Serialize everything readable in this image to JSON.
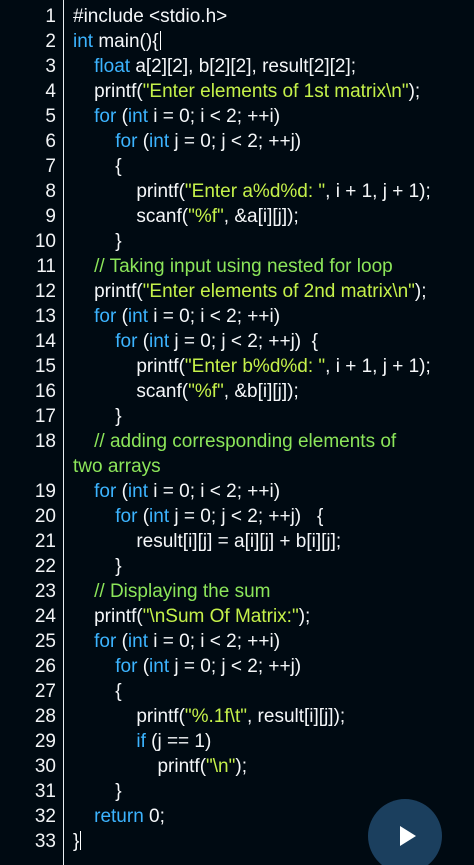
{
  "editor": {
    "lines": [
      {
        "no": "1",
        "tokens": [
          {
            "t": "#include <stdio.h>",
            "c": "plain"
          }
        ]
      },
      {
        "no": "2",
        "tokens": [
          {
            "t": "int",
            "c": "kw"
          },
          {
            "t": " main(){",
            "c": "plain"
          }
        ],
        "cursor": true
      },
      {
        "no": "3",
        "tokens": [
          {
            "t": "    "
          },
          {
            "t": "float",
            "c": "kw"
          },
          {
            "t": " a[2][2], b[2][2], result[2][2];"
          }
        ]
      },
      {
        "no": "4",
        "tokens": [
          {
            "t": "    printf("
          },
          {
            "t": "\"Enter elements of 1st matrix\\n\"",
            "c": "str"
          },
          {
            "t": ");"
          }
        ]
      },
      {
        "no": "5",
        "tokens": [
          {
            "t": "    "
          },
          {
            "t": "for",
            "c": "kw"
          },
          {
            "t": " ("
          },
          {
            "t": "int",
            "c": "kw"
          },
          {
            "t": " i = 0; i < 2; ++i)"
          }
        ]
      },
      {
        "no": "6",
        "tokens": [
          {
            "t": "        "
          },
          {
            "t": "for",
            "c": "kw"
          },
          {
            "t": " ("
          },
          {
            "t": "int",
            "c": "kw"
          },
          {
            "t": " j = 0; j < 2; ++j)"
          }
        ]
      },
      {
        "no": "7",
        "tokens": [
          {
            "t": "        {"
          }
        ]
      },
      {
        "no": "8",
        "tokens": [
          {
            "t": "            printf("
          },
          {
            "t": "\"Enter a%d%d: \"",
            "c": "str"
          },
          {
            "t": ", i + 1, j + 1);"
          }
        ]
      },
      {
        "no": "9",
        "tokens": [
          {
            "t": "            scanf("
          },
          {
            "t": "\"%f\"",
            "c": "str"
          },
          {
            "t": ", &a[i][j]);"
          }
        ]
      },
      {
        "no": "10",
        "tokens": [
          {
            "t": "        }"
          }
        ]
      },
      {
        "no": "11",
        "tokens": [
          {
            "t": "    "
          },
          {
            "t": "// Taking input using nested for loop",
            "c": "com"
          }
        ]
      },
      {
        "no": "12",
        "tokens": [
          {
            "t": "    printf("
          },
          {
            "t": "\"Enter elements of 2nd matrix\\n\"",
            "c": "str"
          },
          {
            "t": ");"
          }
        ]
      },
      {
        "no": "13",
        "tokens": [
          {
            "t": "    "
          },
          {
            "t": "for",
            "c": "kw"
          },
          {
            "t": " ("
          },
          {
            "t": "int",
            "c": "kw"
          },
          {
            "t": " i = 0; i < 2; ++i)"
          }
        ]
      },
      {
        "no": "14",
        "tokens": [
          {
            "t": "        "
          },
          {
            "t": "for",
            "c": "kw"
          },
          {
            "t": " ("
          },
          {
            "t": "int",
            "c": "kw"
          },
          {
            "t": " j = 0; j < 2; ++j)  {"
          }
        ]
      },
      {
        "no": "15",
        "tokens": [
          {
            "t": "            printf("
          },
          {
            "t": "\"Enter b%d%d: \"",
            "c": "str"
          },
          {
            "t": ", i + 1, j + 1);"
          }
        ]
      },
      {
        "no": "16",
        "tokens": [
          {
            "t": "            scanf("
          },
          {
            "t": "\"%f\"",
            "c": "str"
          },
          {
            "t": ", &b[i][j]);"
          }
        ]
      },
      {
        "no": "17",
        "tokens": [
          {
            "t": "        }"
          }
        ]
      },
      {
        "no": "18",
        "tokens": [
          {
            "t": "    "
          },
          {
            "t": "// adding corresponding elements of",
            "c": "com"
          }
        ]
      },
      {
        "no": "",
        "tokens": [
          {
            "t": "two arrays",
            "c": "com"
          }
        ]
      },
      {
        "no": "19",
        "tokens": [
          {
            "t": "    "
          },
          {
            "t": "for",
            "c": "kw"
          },
          {
            "t": " ("
          },
          {
            "t": "int",
            "c": "kw"
          },
          {
            "t": " i = 0; i < 2; ++i)"
          }
        ]
      },
      {
        "no": "20",
        "tokens": [
          {
            "t": "        "
          },
          {
            "t": "for",
            "c": "kw"
          },
          {
            "t": " ("
          },
          {
            "t": "int",
            "c": "kw"
          },
          {
            "t": " j = 0; j < 2; ++j)   {"
          }
        ]
      },
      {
        "no": "21",
        "tokens": [
          {
            "t": "            result[i][j] = a[i][j] + b[i][j];"
          }
        ]
      },
      {
        "no": "22",
        "tokens": [
          {
            "t": "        }"
          }
        ]
      },
      {
        "no": "23",
        "tokens": [
          {
            "t": "    "
          },
          {
            "t": "// Displaying the sum",
            "c": "com"
          }
        ]
      },
      {
        "no": "24",
        "tokens": [
          {
            "t": "    printf("
          },
          {
            "t": "\"\\nSum Of Matrix:\"",
            "c": "str"
          },
          {
            "t": ");"
          }
        ]
      },
      {
        "no": "25",
        "tokens": [
          {
            "t": "    "
          },
          {
            "t": "for",
            "c": "kw"
          },
          {
            "t": " ("
          },
          {
            "t": "int",
            "c": "kw"
          },
          {
            "t": " i = 0; i < 2; ++i)"
          }
        ]
      },
      {
        "no": "26",
        "tokens": [
          {
            "t": "        "
          },
          {
            "t": "for",
            "c": "kw"
          },
          {
            "t": " ("
          },
          {
            "t": "int",
            "c": "kw"
          },
          {
            "t": " j = 0; j < 2; ++j)"
          }
        ]
      },
      {
        "no": "27",
        "tokens": [
          {
            "t": "        {"
          }
        ]
      },
      {
        "no": "28",
        "tokens": [
          {
            "t": "            printf("
          },
          {
            "t": "\"%.1f\\t\"",
            "c": "str"
          },
          {
            "t": ", result[i][j]);"
          }
        ]
      },
      {
        "no": "29",
        "tokens": [
          {
            "t": "            "
          },
          {
            "t": "if",
            "c": "kw"
          },
          {
            "t": " (j == 1)"
          }
        ]
      },
      {
        "no": "30",
        "tokens": [
          {
            "t": "                printf("
          },
          {
            "t": "\"\\n\"",
            "c": "str"
          },
          {
            "t": ");"
          }
        ]
      },
      {
        "no": "31",
        "tokens": [
          {
            "t": "        }"
          }
        ]
      },
      {
        "no": "32",
        "tokens": [
          {
            "t": "    "
          },
          {
            "t": "return",
            "c": "kw"
          },
          {
            "t": " 0;"
          }
        ]
      },
      {
        "no": "33",
        "tokens": [
          {
            "t": "}"
          }
        ],
        "cursor": true
      }
    ]
  },
  "run_button": {
    "icon": "play-icon"
  },
  "colors": {
    "background": "#000a12",
    "keyword": "#3cb4ff",
    "string": "#c5f14a",
    "comment": "#8ce65a",
    "text": "#f5f7f9",
    "run_button": "#1b3f5e"
  }
}
